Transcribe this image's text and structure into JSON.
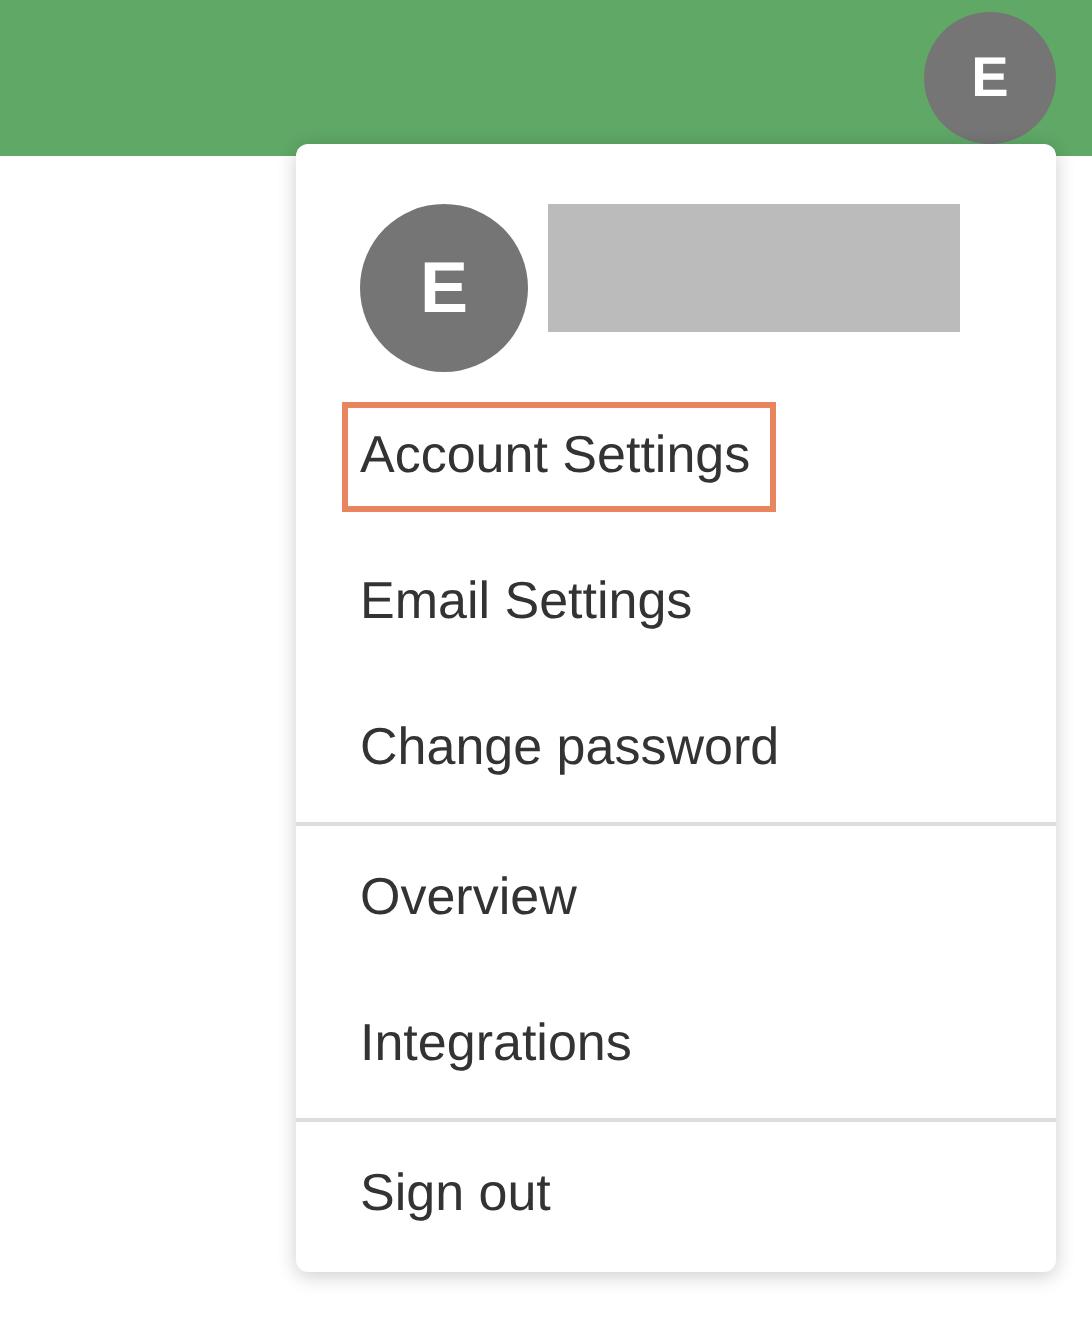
{
  "header": {
    "avatar_initial": "E"
  },
  "menu": {
    "avatar_initial": "E",
    "sections": [
      {
        "items": [
          {
            "label": "Account Settings",
            "highlighted": true
          },
          {
            "label": "Email Settings",
            "highlighted": false
          },
          {
            "label": "Change password",
            "highlighted": false
          }
        ]
      },
      {
        "items": [
          {
            "label": "Overview",
            "highlighted": false
          },
          {
            "label": "Integrations",
            "highlighted": false
          }
        ]
      },
      {
        "items": [
          {
            "label": "Sign out",
            "highlighted": false
          }
        ]
      }
    ]
  }
}
